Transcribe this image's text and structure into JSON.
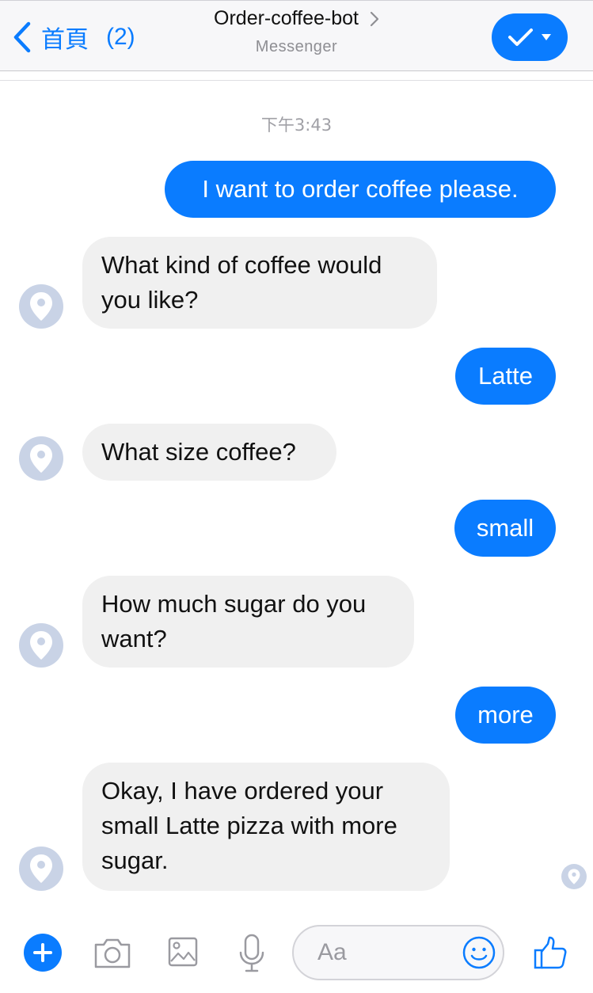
{
  "header": {
    "back_label": "首頁",
    "back_count": "(2)",
    "title": "Order-coffee-bot",
    "subtitle": "Messenger"
  },
  "timestamp": "下午3:43",
  "messages": [
    {
      "from": "user",
      "text": "I want to order coffee please."
    },
    {
      "from": "bot",
      "text": "What kind of coffee would you like?"
    },
    {
      "from": "user",
      "text": "Latte"
    },
    {
      "from": "bot",
      "text": "What size coffee?"
    },
    {
      "from": "user",
      "text": "small"
    },
    {
      "from": "bot",
      "text": "How much sugar do you want?"
    },
    {
      "from": "user",
      "text": "more"
    },
    {
      "from": "bot",
      "text": "Okay, I have ordered your small Latte pizza with more sugar."
    }
  ],
  "composer": {
    "placeholder": "Aa",
    "icons": [
      "plus-icon",
      "camera-icon",
      "image-icon",
      "microphone-icon",
      "emoji-icon",
      "thumbs-up-icon"
    ]
  },
  "colors": {
    "accent": "#0a7cff",
    "incoming_bubble": "#f0f0f0",
    "avatar": "#c9d3e6"
  }
}
